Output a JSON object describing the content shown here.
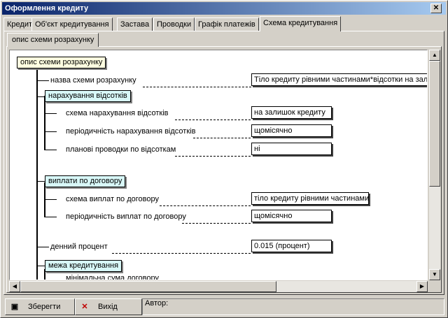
{
  "window": {
    "title": "Оформлення кредиту"
  },
  "tabs": [
    "Кредит",
    "Об'єкт кредитування",
    "Застава",
    "Проводки",
    "Графік платежів",
    "Схема кредитування"
  ],
  "active_tab": "Схема кредитування",
  "subtab": "опис схеми розрахунку",
  "tree": {
    "root": "опис схеми розрахунку",
    "scheme_name": {
      "label": "назва схеми розрахунку",
      "value": "Тіло кредиту рівними частинами*відсотки на залишок"
    },
    "interest": {
      "title": "нарахування відсотків",
      "rows": [
        {
          "label": "схема нарахування відсотків",
          "value": "на залишок кредиту"
        },
        {
          "label": "періодичність нарахування відсотків",
          "value": "щомісячно"
        },
        {
          "label": "планові проводки по відсоткам",
          "value": "ні"
        }
      ]
    },
    "payments": {
      "title": "виплати по договору",
      "rows": [
        {
          "label": "схема виплат по договору",
          "value": "тіло кредиту рівними частинами"
        },
        {
          "label": "періодичність виплат по договору",
          "value": "щомісячно"
        }
      ]
    },
    "daily_rate": {
      "label": "денний процент",
      "value": "0.015   (процент)"
    },
    "limit": {
      "title": "межа кредитування",
      "first_row": "мінімальна сума договору"
    }
  },
  "buttons": {
    "save": "Зберегти",
    "exit": "Вихід"
  },
  "author_label": "Автор:"
}
